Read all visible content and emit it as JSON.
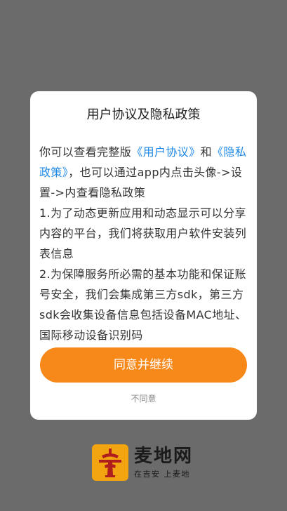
{
  "dialog": {
    "title": "用户协议及隐私政策",
    "body": {
      "p1_prefix": "你可以查看完整版",
      "user_agreement_link": "《用户协议》",
      "p1_and": "和",
      "privacy_policy_link": "《隐私政策》",
      "p1_suffix": "，也可以通过app内点击头像->设置->内查看隐私政策",
      "p2": "1.为了动态更新应用和动态显示可以分享内容的平台，我们将获取用户软件安装列表信息",
      "p3": "2.为保障服务所必需的基本功能和保证账号安全，我们会集成第三方sdk，第三方sdk会收集设备信息包括设备MAC地址、国际移动设备识别码"
    },
    "agree_button": "同意并继续",
    "disagree_link": "不同意"
  },
  "brand": {
    "name": "麦地网",
    "slogan": "在吉安 上麦地",
    "logo_icon": "maidi-logo-icon",
    "logo_color": "#f2a511",
    "logo_mark_color": "#b01e1e"
  },
  "colors": {
    "overlay": "#6b6b6b",
    "accent": "#f7881a",
    "link": "#1e88e5"
  }
}
